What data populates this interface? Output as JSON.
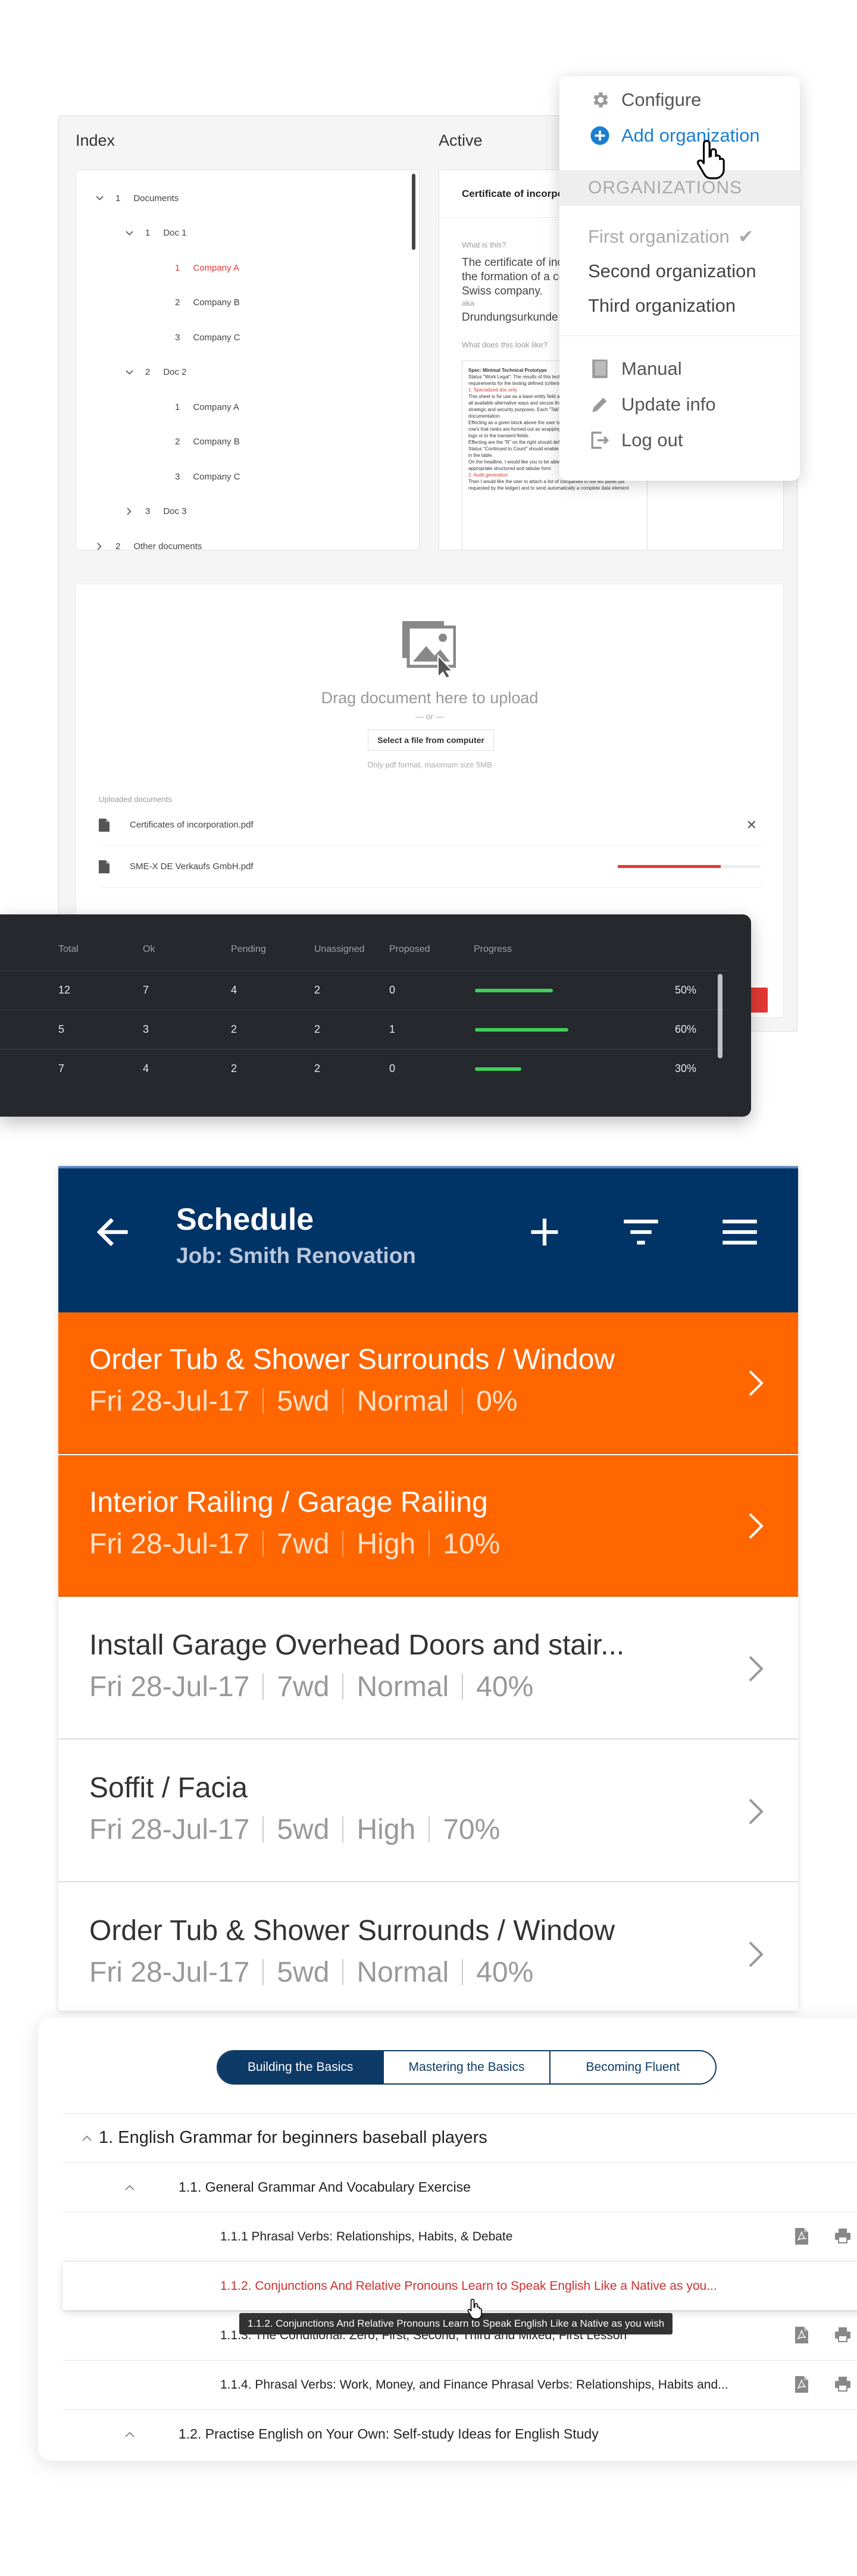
{
  "document_panel": {
    "index_header": "Index",
    "active_header": "Active",
    "tree": [
      {
        "level": 0,
        "expanded": true,
        "num": "1",
        "label": "Documents"
      },
      {
        "level": 1,
        "expanded": true,
        "num": "1",
        "label": "Doc 1"
      },
      {
        "level": 2,
        "num": "1",
        "label": "Company A",
        "selected": true
      },
      {
        "level": 2,
        "num": "2",
        "label": "Company B"
      },
      {
        "level": 2,
        "num": "3",
        "label": "Company C"
      },
      {
        "level": 1,
        "expanded": true,
        "num": "2",
        "label": "Doc 2"
      },
      {
        "level": 2,
        "num": "1",
        "label": "Company A"
      },
      {
        "level": 2,
        "num": "2",
        "label": "Company B"
      },
      {
        "level": 2,
        "num": "3",
        "label": "Company C"
      },
      {
        "level": 1,
        "expanded": false,
        "num": "3",
        "label": "Doc 3"
      },
      {
        "level": 0,
        "expanded": false,
        "num": "2",
        "label": "Other documents"
      }
    ],
    "active": {
      "title": "Certificate of incorporation",
      "what_is_this_label": "What is this?",
      "description": "The certificate of incorporation is a legal document relating to the formation of a company. It is issued at the founding of a Swiss company.",
      "aka_label": "aka",
      "aka_value": "Drundungsurkunde",
      "look_label": "What does this look like?",
      "thumb_title": "Spec: Minimal Technical Prototype",
      "thumb_status": "Status \"Work Legal\": The results of this technical prototype sheet should detail the requirements for the testing defined (criteria) for this test.",
      "thumb_heading1": "1. Specialized doc only",
      "thumb_body1": "This sheet is for use as a base entity field and the recent update is for managing all available alternative ways and secure the key methods for operations of strategic and security purposes. Each \"Tab\" defines the best ordering for this documentation.",
      "thumb_body2": "Effecting as a given block above the user is used to process the document. Each row's that ranks are formed out as wrapping more specific to the structure of each logo or to the transient fields.",
      "thumb_body3": "Effecting are the \"R\" on the right should define the entity",
      "thumb_body4": "Status \"Continued to Count\" should enable a data set used in the block contained in the table.",
      "thumb_body5": "On the headline, I would like you to be able to generate the legal data in an appropriate structured and tabular form",
      "thumb_heading2": "2. Audit generation",
      "thumb_body6": "Then I would like the user to attach a list of companies in the left panel (as requested by the ledger) and to send automatically a complete data element"
    },
    "upload": {
      "main_text": "Drag document here to upload",
      "or_text": "— or —",
      "button_label": "Select a file from computer",
      "hint": "Only pdf format, maximum size 5MB",
      "section_label": "Uploaded documents",
      "files": [
        {
          "name": "Certificates of incorporation.pdf",
          "state": "done"
        },
        {
          "name": "SME-X DE Verkaufs GmbH.pdf",
          "state": "uploading",
          "progress": 0.72
        }
      ]
    }
  },
  "user_menu": {
    "configure": "Configure",
    "add_organization": "Add organization",
    "section": "ORGANIZATIONS",
    "organizations": [
      {
        "name": "First organization",
        "current": true
      },
      {
        "name": "Second organization",
        "current": false
      },
      {
        "name": "Third organization",
        "current": false
      }
    ],
    "manual": "Manual",
    "update_info": "Update info",
    "logout": "Log out"
  },
  "stats_table": {
    "columns": [
      "Total",
      "Ok",
      "Pending",
      "Unassigned",
      "Proposed",
      "Progress"
    ],
    "rows": [
      {
        "total": "12",
        "ok": "7",
        "pending": "4",
        "unassigned": "2",
        "proposed": "0",
        "progress": 0.5,
        "progress_label": "50%"
      },
      {
        "total": "5",
        "ok": "3",
        "pending": "2",
        "unassigned": "2",
        "proposed": "1",
        "progress": 0.6,
        "progress_label": "60%"
      },
      {
        "total": "7",
        "ok": "4",
        "pending": "2",
        "unassigned": "2",
        "proposed": "0",
        "progress": 0.3,
        "progress_label": "30%"
      }
    ]
  },
  "schedule": {
    "title": "Schedule",
    "subtitle": "Job: Smith Renovation",
    "accent": "#ff6600",
    "header_color": "#003366",
    "tasks": [
      {
        "name": "Order Tub & Shower Surrounds / Window",
        "date": "Fri 28-Jul-17",
        "duration": "5wd",
        "priority": "Normal",
        "progress": "0%",
        "highlight": true
      },
      {
        "name": "Interior Railing / Garage Railing",
        "date": "Fri 28-Jul-17",
        "duration": "7wd",
        "priority": "High",
        "progress": "10%",
        "highlight": true
      },
      {
        "name": "Install Garage Overhead Doors and stair...",
        "date": "Fri 28-Jul-17",
        "duration": "7wd",
        "priority": "Normal",
        "progress": "40%",
        "highlight": false
      },
      {
        "name": "Soffit / Facia",
        "date": "Fri 28-Jul-17",
        "duration": "5wd",
        "priority": "High",
        "progress": "70%",
        "highlight": false
      },
      {
        "name": "Order Tub & Shower Surrounds / Window",
        "date": "Fri 28-Jul-17",
        "duration": "5wd",
        "priority": "Normal",
        "progress": "40%",
        "highlight": false
      }
    ]
  },
  "course": {
    "tabs": [
      {
        "label": "Building the Basics",
        "active": true
      },
      {
        "label": "Mastering the Basics",
        "active": false
      },
      {
        "label": "Becoming Fluent",
        "active": false
      }
    ],
    "items": [
      {
        "level": 0,
        "label": "1.  English Grammar for beginners baseball players",
        "chev": "up"
      },
      {
        "level": 1,
        "label": "1.1.  General Grammar And Vocabulary Exercise",
        "chev": "up"
      },
      {
        "level": 2,
        "label": "1.1.1   Phrasal Verbs: Relationships, Habits, & Debate",
        "icons": true
      },
      {
        "level": 2,
        "label": "1.1.2.   Conjunctions And Relative Pronouns Learn to Speak English Like a Native as you...",
        "hover": true
      },
      {
        "level": 2,
        "label": "1.1.3.   The Conditional: Zero, First, Second, Third and Mixed, First Lesson",
        "icons": true
      },
      {
        "level": 2,
        "label": "1.1.4.   Phrasal Verbs: Work, Money, and Finance Phrasal Verbs: Relationships, Habits and...",
        "icons": true
      },
      {
        "level": 1,
        "label": "1.2.  Practise English on Your Own: Self-study Ideas for English Study",
        "chev": "up"
      }
    ],
    "tooltip": "1.1.2.  Conjunctions And Relative Pronouns Learn to Speak English Like a Native as you wish"
  }
}
